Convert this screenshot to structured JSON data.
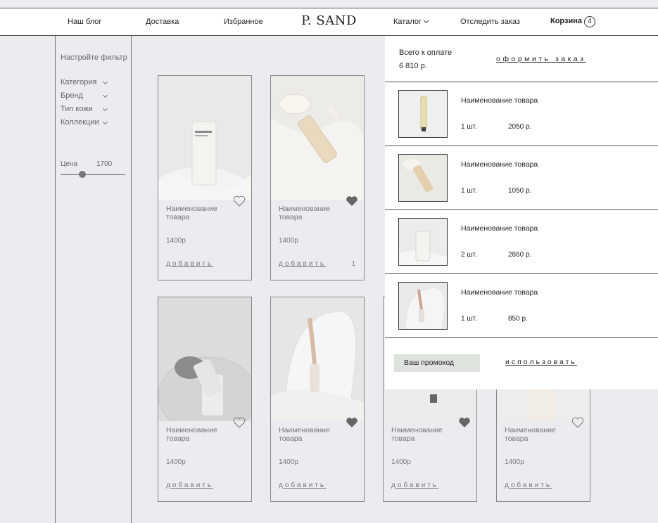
{
  "header": {
    "nav": {
      "blog": "Наш блог",
      "delivery": "Доставка",
      "favorites": "Избранное",
      "catalog": "Каталог",
      "track_order": "Отследить заказ",
      "cart": "Корзина"
    },
    "logo": "P. SAND",
    "cart_count": "4"
  },
  "filter": {
    "title": "Настройте фильтр",
    "items": [
      "Категория",
      "Бренд",
      "Тип кожи",
      "Коллекции"
    ],
    "price_label": "Цена",
    "price_value": "1700"
  },
  "products": [
    {
      "name": "Наименование товара",
      "price": "1400р",
      "add": "добавить",
      "favorite": false,
      "qty": ""
    },
    {
      "name": "Наименование товара",
      "price": "1400р",
      "add": "добавить",
      "favorite": true,
      "qty": "1"
    },
    {
      "name": "Наименование товара",
      "price": "1400р",
      "add": "добавить",
      "favorite": false,
      "qty": ""
    },
    {
      "name": "Наименование товара",
      "price": "1400р",
      "add": "добавить",
      "favorite": true,
      "qty": ""
    },
    {
      "name": "Наименование товара",
      "price": "1400р",
      "add": "добавить",
      "favorite": true,
      "qty": ""
    },
    {
      "name": "Наименование товара",
      "price": "1400р",
      "add": "добавить",
      "favorite": false,
      "qty": ""
    }
  ],
  "cart": {
    "total_label": "Всего к оплате",
    "total_value": "6 810 р.",
    "checkout": "оформить заказ",
    "items": [
      {
        "name": "Наименование товара",
        "qty": "1 шт.",
        "price": "2050 р."
      },
      {
        "name": "Наименование товара",
        "qty": "1 шт.",
        "price": "1050 р."
      },
      {
        "name": "Наименование товара",
        "qty": "2 шт.",
        "price": "2860 р."
      },
      {
        "name": "Наименование товара",
        "qty": "1 шт.",
        "price": "850 р."
      }
    ],
    "promo_placeholder": "Ваш промокод",
    "promo_apply": "использовать"
  },
  "colors": {
    "page_bg": "#ebebf0",
    "panel_bg": "#ffffff",
    "heart_fill": "#666666",
    "promo_bg": "#dfe3dd"
  }
}
